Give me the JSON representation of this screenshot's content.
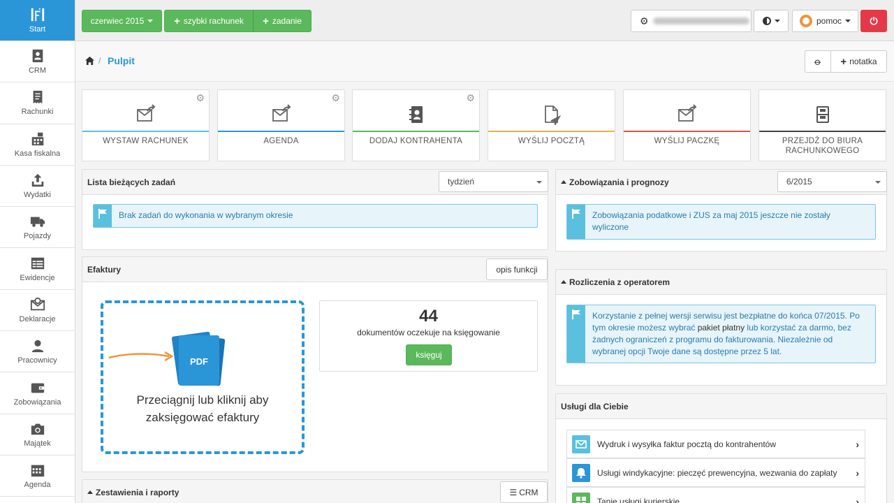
{
  "colors": {
    "accent": "#2a96d8",
    "green": "#5cb85c",
    "red": "#e5384a",
    "info": "#5bc0de"
  },
  "sidebar": {
    "items": [
      {
        "label": "Start",
        "icon": "ifi-logo-icon"
      },
      {
        "label": "CRM",
        "icon": "contacts-icon"
      },
      {
        "label": "Rachunki",
        "icon": "receipt-icon"
      },
      {
        "label": "Kasa fiskalna",
        "icon": "cash-register-icon"
      },
      {
        "label": "Wydatki",
        "icon": "upload-icon"
      },
      {
        "label": "Pojazdy",
        "icon": "truck-icon"
      },
      {
        "label": "Ewidencje",
        "icon": "table-icon"
      },
      {
        "label": "Deklaracje",
        "icon": "envelope-icon"
      },
      {
        "label": "Pracownicy",
        "icon": "user-icon"
      },
      {
        "label": "Zobowiązania",
        "icon": "wallet-icon"
      },
      {
        "label": "Majątek",
        "icon": "camera-icon"
      },
      {
        "label": "Agenda",
        "icon": "calendar-icon"
      }
    ]
  },
  "topbar": {
    "month": "czerwiec 2015",
    "quick_invoice": "szybki rachunek",
    "task": "zadanie",
    "help": "pomoc"
  },
  "breadcrumb": {
    "current": "Pulpit",
    "note": "notatka"
  },
  "tiles": [
    {
      "label": "WYSTAW RACHUNEK",
      "color": "#5bc0de"
    },
    {
      "label": "AGENDA",
      "color": "#2a96d8"
    },
    {
      "label": "DODAJ KONTRAHENTA",
      "color": "#5cb85c"
    },
    {
      "label": "WYŚLIJ POCZTĄ",
      "color": "#f0ad4e"
    },
    {
      "label": "WYŚLIJ PACZKĘ",
      "color": "#d9534f"
    },
    {
      "label": "PRZEJDŹ DO BIURA RACHUNKOWEGO",
      "color": "#444444"
    }
  ],
  "tasks": {
    "title": "Lista bieżących zadań",
    "period": "tydzień",
    "empty": "Brak zadań do wykonania w wybranym okresie"
  },
  "efaktury": {
    "title": "Efaktury",
    "help": "opis funkcji",
    "drop_text": "Przeciągnij lub kliknij aby zaksięgować efaktury",
    "pdf": "PDF",
    "count": "44",
    "count_label": "dokumentów oczekuje na księgowanie",
    "book": "księguj"
  },
  "reports": {
    "title": "Zestawienia i raporty",
    "crm": "CRM"
  },
  "obligations": {
    "title": "Zobowiązania i prognozy",
    "period": "6/2015",
    "message": "Zobowiązania podatkowe i ZUS za maj 2015 jeszcze nie zostały wyliczone"
  },
  "operator": {
    "title": "Rozliczenia z operatorem",
    "msg1": "Korzystanie z pełnej wersji serwisu jest bezpłatne do końca 07/2015. Po tym okresie możesz wybrać ",
    "msg_link": "pakiet płatny",
    "msg2": " lub korzystać za darmo, bez żadnych ograniczeń z programu do fakturowania. Niezależnie od wybranej opcji Twoje dane są dostępne przez 5 lat."
  },
  "services": {
    "title": "Usługi dla Ciebie",
    "items": [
      {
        "label": "Wydruk i wysyłka faktur pocztą do kontrahentów",
        "color": "#5bc0de"
      },
      {
        "label": "Usługi windykacyjne: pieczęć prewencyjna, wezwania do zapłaty",
        "color": "#2a96d8"
      },
      {
        "label": "Tanie usługi kurierskie",
        "color": "#5cb85c"
      }
    ]
  }
}
